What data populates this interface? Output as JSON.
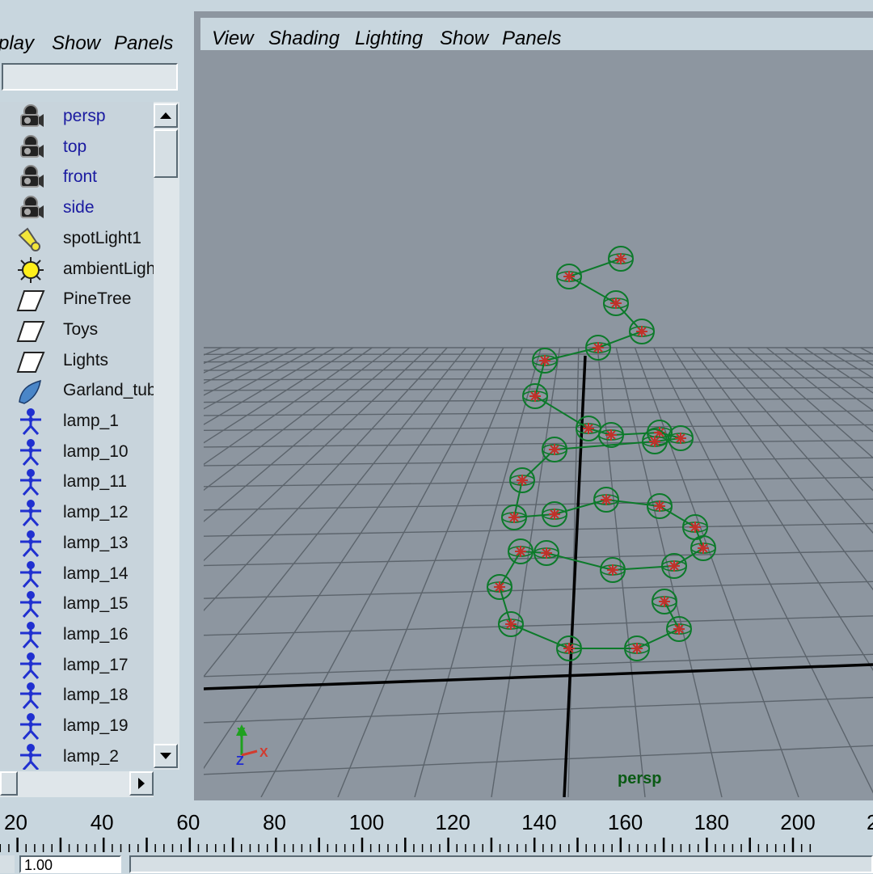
{
  "outliner": {
    "menu": [
      "play",
      "Show",
      "Panels"
    ],
    "filter_value": "",
    "items": [
      {
        "label": "persp",
        "type": "camera"
      },
      {
        "label": "top",
        "type": "camera"
      },
      {
        "label": "front",
        "type": "camera"
      },
      {
        "label": "side",
        "type": "camera"
      },
      {
        "label": "spotLight1",
        "type": "spotlight"
      },
      {
        "label": "ambientLight",
        "type": "ambientlight"
      },
      {
        "label": "PineTree",
        "type": "layer"
      },
      {
        "label": "Toys",
        "type": "layer"
      },
      {
        "label": "Lights",
        "type": "layer"
      },
      {
        "label": "Garland_tube",
        "type": "curve"
      },
      {
        "label": "lamp_1",
        "type": "joint"
      },
      {
        "label": "lamp_10",
        "type": "joint"
      },
      {
        "label": "lamp_11",
        "type": "joint"
      },
      {
        "label": "lamp_12",
        "type": "joint"
      },
      {
        "label": "lamp_13",
        "type": "joint"
      },
      {
        "label": "lamp_14",
        "type": "joint"
      },
      {
        "label": "lamp_15",
        "type": "joint"
      },
      {
        "label": "lamp_16",
        "type": "joint"
      },
      {
        "label": "lamp_17",
        "type": "joint"
      },
      {
        "label": "lamp_18",
        "type": "joint"
      },
      {
        "label": "lamp_19",
        "type": "joint"
      },
      {
        "label": "lamp_2",
        "type": "joint"
      }
    ]
  },
  "viewport": {
    "menu": [
      "View",
      "Shading",
      "Lighting",
      "Show",
      "Panels"
    ],
    "camera_label": "persp",
    "axis_labels": {
      "x": "X",
      "y": "Y",
      "z": "Z"
    },
    "colors": {
      "background": "#8d96a0",
      "grid": "#5c646c",
      "axis": "#000000",
      "curve": "#0c7a2a",
      "lamp_center": "#c0322a"
    }
  },
  "timeline": {
    "ticks": [
      "20",
      "40",
      "60",
      "80",
      "100",
      "120",
      "140",
      "160",
      "180",
      "200",
      "2"
    ],
    "range_start": "1.00"
  }
}
